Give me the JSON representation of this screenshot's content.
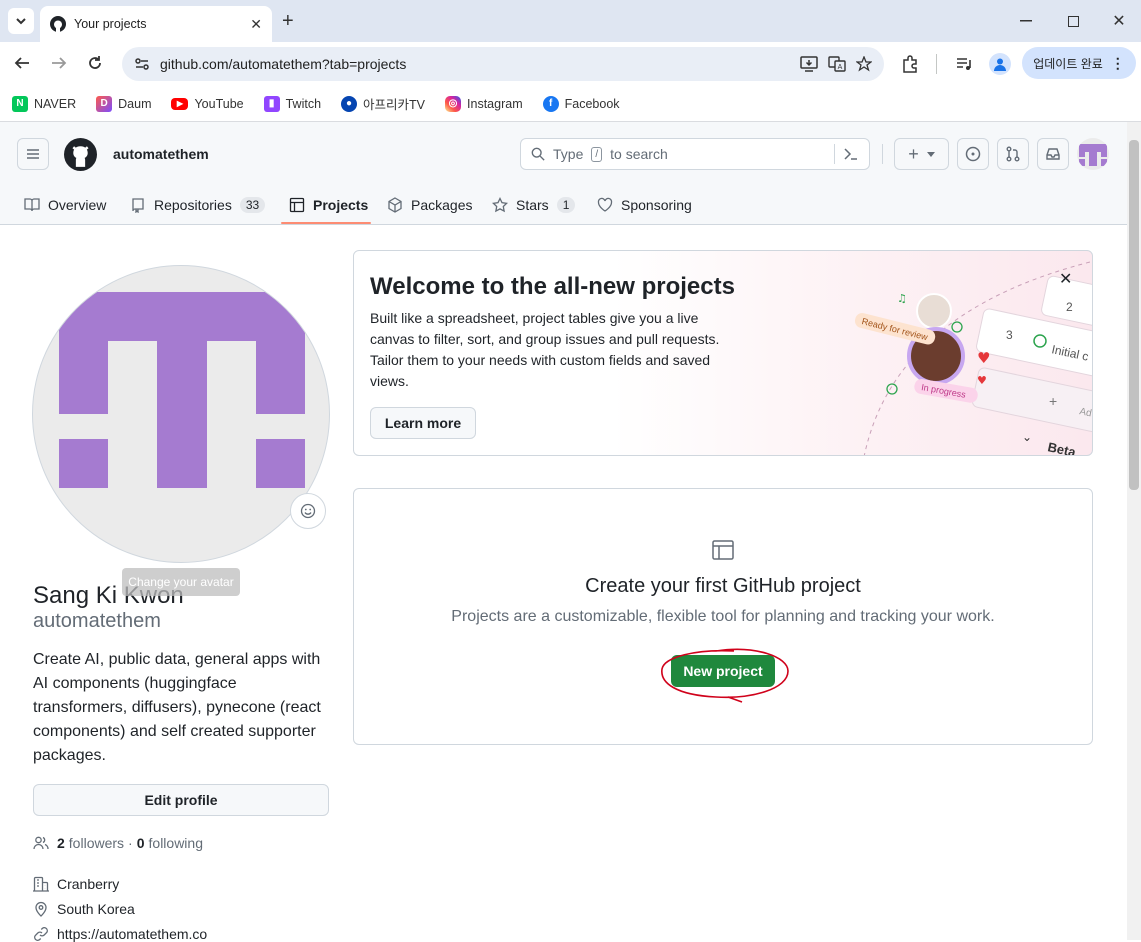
{
  "browser": {
    "tab_title": "Your projects",
    "url": "github.com/automatethem?tab=projects",
    "update_label": "업데이트 완료",
    "bookmarks": [
      {
        "label": "NAVER",
        "icon": "naver-icon",
        "color": "#03c75a"
      },
      {
        "label": "Daum",
        "icon": "daum-icon",
        "color": "#ff5a4a"
      },
      {
        "label": "YouTube",
        "icon": "youtube-icon",
        "color": "#ff0000"
      },
      {
        "label": "Twitch",
        "icon": "twitch-icon",
        "color": "#9146ff"
      },
      {
        "label": "아프리카TV",
        "icon": "afreecatv-icon",
        "color": "#0545b1"
      },
      {
        "label": "Instagram",
        "icon": "instagram-icon",
        "color": "#d6249f"
      },
      {
        "label": "Facebook",
        "icon": "facebook-icon",
        "color": "#1877f2"
      }
    ]
  },
  "header": {
    "username": "automatethem",
    "search_prefix": "Type",
    "search_key": "/",
    "search_suffix": "to search",
    "tabs": [
      {
        "label": "Overview",
        "icon": "book-icon"
      },
      {
        "label": "Repositories",
        "icon": "repo-icon",
        "count": "33"
      },
      {
        "label": "Projects",
        "icon": "table-icon",
        "selected": true
      },
      {
        "label": "Packages",
        "icon": "package-icon"
      },
      {
        "label": "Stars",
        "icon": "star-icon",
        "count": "1"
      },
      {
        "label": "Sponsoring",
        "icon": "heart-icon"
      }
    ]
  },
  "profile": {
    "change_avatar_tooltip": "Change your avatar",
    "full_name": "Sang Ki Kwon",
    "login": "automatethem",
    "bio": "Create AI, public data, general apps with AI components (huggingface transformers, diffusers), pynecone (react components) and self created supporter packages.",
    "edit_label": "Edit profile",
    "followers_count": "2",
    "followers_label": "followers",
    "sep": "·",
    "following_count": "0",
    "following_label": "following",
    "company": "Cranberry",
    "location": "South Korea",
    "website": "https://automatethem.co"
  },
  "welcome": {
    "title": "Welcome to the all-new projects",
    "body": "Built like a spreadsheet, project tables give you a live canvas to filter, sort, and group issues and pull requests. Tailor them to your needs with custom fields and saved views.",
    "learn_more": "Learn more",
    "illus_ready": "Ready for review",
    "illus_progress": "In progress",
    "illus_initial": "Initial c",
    "illus_num2": "2",
    "illus_num3": "3",
    "illus_beta": "Beta",
    "illus_add": "Ad"
  },
  "empty": {
    "title": "Create your first GitHub project",
    "subtitle": "Projects are a customizable, flexible tool for planning and tracking your work.",
    "button": "New project"
  },
  "colors": {
    "accent": "#fd8c73",
    "primary_green": "#1f883d",
    "avatar_purple": "#a57bd0",
    "annotation_red": "#d0021b"
  }
}
